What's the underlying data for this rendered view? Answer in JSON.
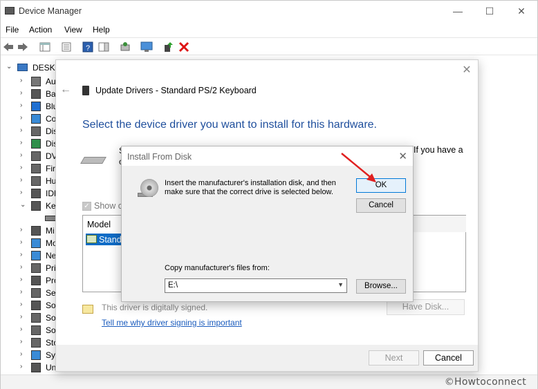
{
  "window": {
    "title": "Device Manager",
    "menu": [
      "File",
      "Action",
      "View",
      "Help"
    ],
    "minimize": "—",
    "maximize": "☐",
    "close": "✕"
  },
  "tree": {
    "root": "DESKTO",
    "items": [
      {
        "label": "Au",
        "icon": "audio-icon"
      },
      {
        "label": "Bat",
        "icon": "battery-icon"
      },
      {
        "label": "Blu",
        "icon": "bluetooth-icon"
      },
      {
        "label": "Co",
        "icon": "computer-icon"
      },
      {
        "label": "Dis",
        "icon": "disk-drive-icon"
      },
      {
        "label": "Dis",
        "icon": "display-adapter-icon"
      },
      {
        "label": "DV",
        "icon": "dvd-drive-icon"
      },
      {
        "label": "Fir",
        "icon": "firmware-icon"
      },
      {
        "label": "Hu",
        "icon": "hid-icon"
      },
      {
        "label": "IDE",
        "icon": "ide-controller-icon"
      },
      {
        "label": "Key",
        "icon": "keyboard-icon",
        "expanded": true
      },
      {
        "label": "",
        "icon": "keyboard-device-icon"
      },
      {
        "label": "Mi",
        "icon": "mouse-icon"
      },
      {
        "label": "Mo",
        "icon": "monitor-icon"
      },
      {
        "label": "Ne",
        "icon": "network-adapter-icon"
      },
      {
        "label": "Pri",
        "icon": "print-queue-icon"
      },
      {
        "label": "Pro",
        "icon": "processor-icon"
      },
      {
        "label": "Sec",
        "icon": "security-device-icon"
      },
      {
        "label": "Sof",
        "icon": "software-component-icon"
      },
      {
        "label": "Sof",
        "icon": "software-device-icon"
      },
      {
        "label": "Sou",
        "icon": "sound-icon"
      },
      {
        "label": "Sto",
        "icon": "storage-controller-icon"
      },
      {
        "label": "Sys",
        "icon": "system-device-icon"
      },
      {
        "label": "Un",
        "icon": "usb-controller-icon"
      }
    ]
  },
  "update_dialog": {
    "title": "Update Drivers - Standard PS/2 Keyboard",
    "heading": "Select the device driver you want to install for this hardware.",
    "desc_line1": "S",
    "desc_line2": "c",
    "desc_right": "If you have a",
    "show_compatible": "Show co",
    "list_header": "Model",
    "list_item": "Standa",
    "signed_text": "This driver is digitally signed.",
    "have_disk": "Have Disk...",
    "signing_link": "Tell me why driver signing is important",
    "next": "Next",
    "cancel": "Cancel",
    "close": "✕",
    "back": "←"
  },
  "install_dialog": {
    "title": "Install From Disk",
    "close": "✕",
    "message_line1": "Insert the manufacturer's installation disk, and then",
    "message_line2": "make sure that the correct drive is selected below.",
    "ok": "OK",
    "cancel": "Cancel",
    "copy_label": "Copy manufacturer's files from:",
    "path_value": "E:\\",
    "browse": "Browse..."
  },
  "watermark": "©Howtoconnect",
  "colors": {
    "heading_blue": "#1e4e9c",
    "selection_blue": "#0f6cc6",
    "link_blue": "#1a5bbd",
    "annotation_red": "#e02020"
  }
}
